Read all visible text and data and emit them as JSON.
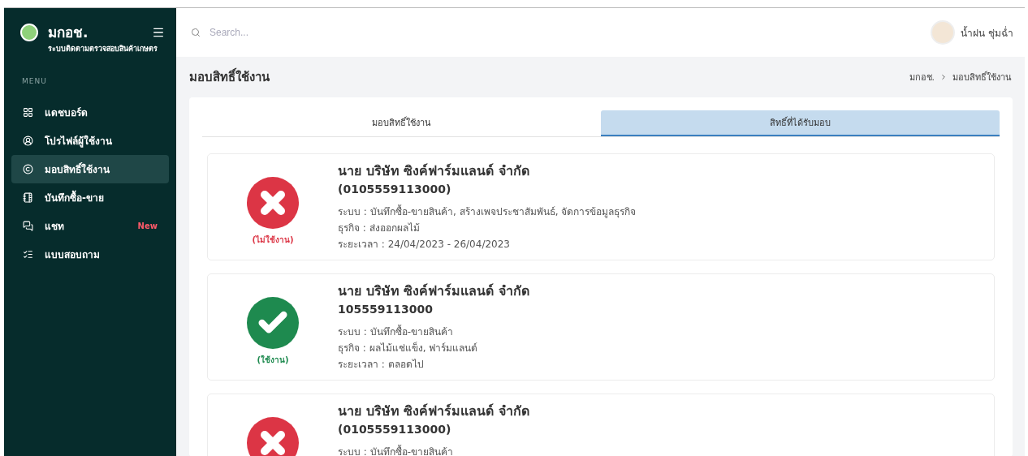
{
  "sidebar": {
    "brand": "มกอช.",
    "subtitle": "ระบบติดตามตรวจสอบสินค้าเกษตร",
    "section": "MENU",
    "items": [
      {
        "label": "แดชบอร์ด",
        "kind": "dashboard",
        "selected": false
      },
      {
        "label": "โปรไฟล์ผู้ใช้งาน",
        "kind": "profile",
        "selected": false
      },
      {
        "label": "มอบสิทธิ์ใช้งาน",
        "kind": "permission",
        "selected": true
      },
      {
        "label": "บันทึกซื้อ-ขาย",
        "kind": "record",
        "selected": false
      },
      {
        "label": "แชท",
        "kind": "chat",
        "selected": false,
        "badge": "New"
      },
      {
        "label": "แบบสอบถาม",
        "kind": "survey",
        "selected": false
      }
    ]
  },
  "header": {
    "search": {
      "placeholder": "Search..."
    },
    "user": "น้ำฝน ชุ่มฉ่ำ"
  },
  "page": {
    "title": "มอบสิทธิ์ใช้งาน",
    "breadcrumb": [
      "มกอช.",
      "มอบสิทธิ์ใช้งาน"
    ]
  },
  "tabs": [
    {
      "label": "มอบสิทธิ์ใช้งาน",
      "selected": false
    },
    {
      "label": "สิทธิ์ที่ได้รับมอบ",
      "selected": true
    }
  ],
  "grants": [
    {
      "active": false,
      "status": "(ไม่ใช้งาน)",
      "name": "นาย บริษัท ซิงค์ฟาร์มแลนด์ จำกัด",
      "tax_id": "(0105559113000)",
      "details": [
        "ระบบ : บันทึกซื้อ-ขายสินค้า, สร้างเพจประชาสัมพันธ์, จัดการข้อมูลธุรกิจ",
        "ธุรกิจ : ส่งออกผลไม้",
        "ระยะเวลา : 24/04/2023 - 26/04/2023"
      ]
    },
    {
      "active": true,
      "status": "(ใช้งาน)",
      "name": "นาย บริษัท ซิงค์ฟาร์มแลนด์ จำกัด",
      "tax_id": "105559113000",
      "details": [
        "ระบบ : บันทึกซื้อ-ขายสินค้า",
        "ธุรกิจ : ผลไม้แช่แข็ง, ฟาร์มแลนด์",
        "ระยะเวลา : ตลอดไป"
      ]
    },
    {
      "active": false,
      "name": "นาย บริษัท ซิงค์ฟาร์มแลนด์ จำกัด",
      "tax_id": "(0105559113000)",
      "details": [
        "ระบบ : บันทึกซื้อ-ขายสินค้า"
      ]
    }
  ]
}
